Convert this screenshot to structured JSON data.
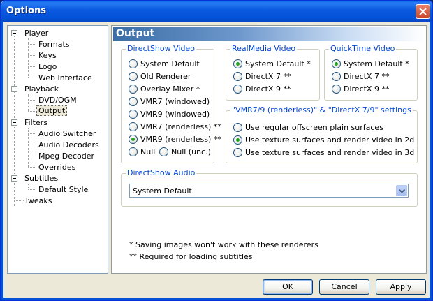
{
  "window": {
    "title": "Options"
  },
  "tree": {
    "items": [
      {
        "label": "Player",
        "level": 0,
        "expandable": true
      },
      {
        "label": "Formats",
        "level": 1
      },
      {
        "label": "Keys",
        "level": 1
      },
      {
        "label": "Logo",
        "level": 1
      },
      {
        "label": "Web Interface",
        "level": 1
      },
      {
        "label": "Playback",
        "level": 0,
        "expandable": true
      },
      {
        "label": "DVD/OGM",
        "level": 1
      },
      {
        "label": "Output",
        "level": 1,
        "selected": true
      },
      {
        "label": "Filters",
        "level": 0,
        "expandable": true
      },
      {
        "label": "Audio Switcher",
        "level": 1
      },
      {
        "label": "Audio Decoders",
        "level": 1
      },
      {
        "label": "Mpeg Decoder",
        "level": 1
      },
      {
        "label": "Overrides",
        "level": 1
      },
      {
        "label": "Subtitles",
        "level": 0,
        "expandable": true
      },
      {
        "label": "Default Style",
        "level": 1
      },
      {
        "label": "Tweaks",
        "level": 0
      }
    ]
  },
  "panel": {
    "title": "Output",
    "directshow_video": {
      "label": "DirectShow Video",
      "options": [
        {
          "label": "System Default",
          "checked": false
        },
        {
          "label": "Old Renderer",
          "checked": false
        },
        {
          "label": "Overlay Mixer *",
          "checked": false
        },
        {
          "label": "VMR7 (windowed)",
          "checked": false
        },
        {
          "label": "VMR9 (windowed)",
          "checked": false
        },
        {
          "label": "VMR7 (renderless) **",
          "checked": false
        },
        {
          "label": "VMR9 (renderless) **",
          "checked": true
        },
        {
          "label": "Null",
          "checked": false
        },
        {
          "label": "Null (unc.)",
          "checked": false
        }
      ]
    },
    "realmedia_video": {
      "label": "RealMedia Video",
      "options": [
        {
          "label": "System Default *",
          "checked": true
        },
        {
          "label": "DirectX 7 **",
          "checked": false
        },
        {
          "label": "DirectX 9 **",
          "checked": false
        }
      ]
    },
    "quicktime_video": {
      "label": "QuickTime Video",
      "options": [
        {
          "label": "System Default *",
          "checked": true
        },
        {
          "label": "DirectX 7 **",
          "checked": false
        },
        {
          "label": "DirectX 9 **",
          "checked": false
        }
      ]
    },
    "renderless_settings": {
      "label": "\"VMR7/9 (renderless)\" & \"DirectX 7/9\" settings",
      "options": [
        {
          "label": "Use regular offscreen plain surfaces",
          "checked": false
        },
        {
          "label": "Use texture surfaces and render video in 2d",
          "checked": true
        },
        {
          "label": "Use texture surfaces and render video in 3d",
          "checked": false
        }
      ]
    },
    "directshow_audio": {
      "label": "DirectShow Audio",
      "selected": "System Default"
    },
    "notes": [
      "* Saving images won't work with these renderers",
      "** Required for loading subtitles"
    ]
  },
  "buttons": {
    "ok": "OK",
    "cancel": "Cancel",
    "apply": "Apply"
  },
  "colors": {
    "accent": "#0046d5",
    "title_bar": "#0453d7",
    "radio_checked": "#21a121"
  }
}
